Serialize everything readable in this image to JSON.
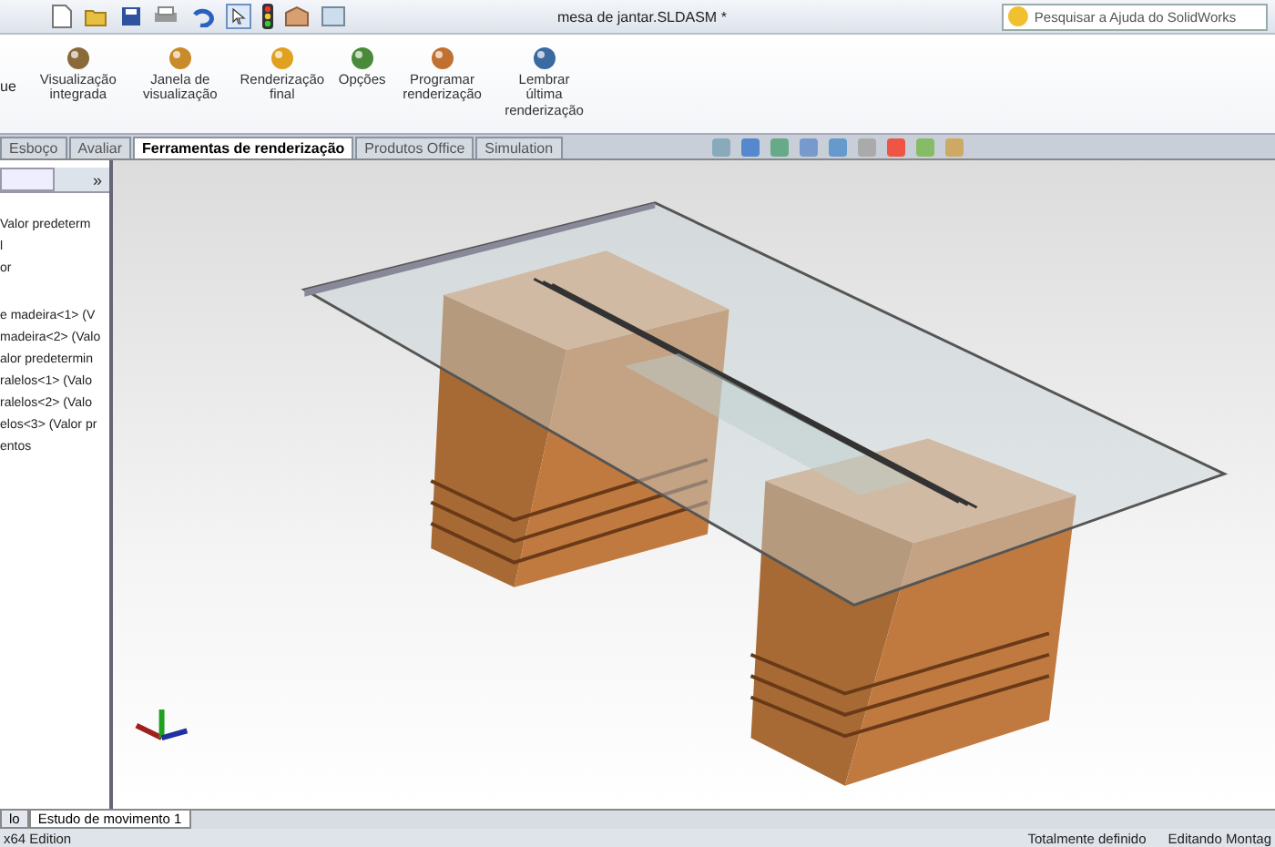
{
  "window": {
    "title": "mesa de jantar.SLDASM *"
  },
  "search": {
    "placeholder": "Pesquisar a Ajuda do SolidWorks"
  },
  "ribbon": {
    "cut_label": "ue",
    "buttons": [
      {
        "label": "Visualização integrada"
      },
      {
        "label": "Janela de visualização"
      },
      {
        "label": "Renderização final"
      },
      {
        "label": "Opções"
      },
      {
        "label": "Programar renderização"
      },
      {
        "label": "Lembrar última renderização"
      }
    ]
  },
  "tabs": [
    {
      "label": "Esboço",
      "selected": false
    },
    {
      "label": "Avaliar",
      "selected": false
    },
    {
      "label": "Ferramentas de renderização",
      "selected": true
    },
    {
      "label": "Produtos Office",
      "selected": false
    },
    {
      "label": "Simulation",
      "selected": false
    }
  ],
  "panel": {
    "collapse": "»",
    "items": [
      {
        "label": "Valor predeterm"
      },
      {
        "label": "l"
      },
      {
        "label": "or"
      },
      {
        "label": "e madeira<1> (V"
      },
      {
        "label": "madeira<2> (Valo"
      },
      {
        "label": "alor predetermin"
      },
      {
        "label": "ralelos<1> (Valo"
      },
      {
        "label": "ralelos<2> (Valo"
      },
      {
        "label": "elos<3> (Valor pr"
      },
      {
        "label": "entos"
      }
    ]
  },
  "bottom_tabs": [
    {
      "label": "lo",
      "selected": false
    },
    {
      "label": "Estudo de movimento 1",
      "selected": true
    }
  ],
  "status_bar": {
    "left": "x64 Edition",
    "items": [
      "Totalmente definido",
      "Editando Montag"
    ]
  }
}
